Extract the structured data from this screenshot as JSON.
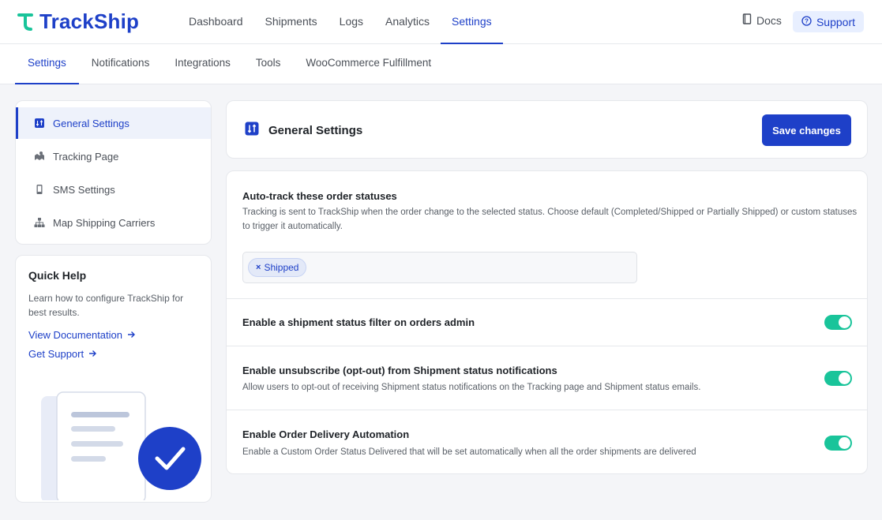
{
  "app": {
    "logo_text": "TrackShip",
    "brand_color": "#1e40c8",
    "accent_color": "#19c49a"
  },
  "topnav": {
    "items": [
      {
        "label": "Dashboard",
        "active": false
      },
      {
        "label": "Shipments",
        "active": false
      },
      {
        "label": "Logs",
        "active": false
      },
      {
        "label": "Analytics",
        "active": false
      },
      {
        "label": "Settings",
        "active": true
      }
    ],
    "docs_label": "Docs",
    "docs_icon": "book-icon",
    "support_label": "Support",
    "support_icon": "help-circle-icon"
  },
  "subnav": {
    "items": [
      {
        "label": "Settings",
        "active": true
      },
      {
        "label": "Notifications",
        "active": false
      },
      {
        "label": "Integrations",
        "active": false
      },
      {
        "label": "Tools",
        "active": false
      },
      {
        "label": "WooCommerce Fulfillment",
        "active": false
      }
    ]
  },
  "sidebar": {
    "items": [
      {
        "label": "General Settings",
        "icon": "sliders-icon",
        "active": true
      },
      {
        "label": "Tracking Page",
        "icon": "map-icon",
        "active": false
      },
      {
        "label": "SMS Settings",
        "icon": "phone-icon",
        "active": false
      },
      {
        "label": "Map Shipping Carriers",
        "icon": "sitemap-icon",
        "active": false
      }
    ]
  },
  "quick_help": {
    "title": "Quick Help",
    "text": "Learn how to configure TrackShip for best results.",
    "doc_link": "View Documentation",
    "support_link": "Get Support"
  },
  "main": {
    "title": "General Settings",
    "title_icon": "sliders-icon",
    "save_label": "Save changes",
    "settings": [
      {
        "title": "Auto-track these order statuses",
        "description": "Tracking is sent to TrackShip when the order change to the selected status. Choose default (Completed/Shipped or Partially Shipped) or custom statuses to trigger it automatically.",
        "selected_chip": "Shipped",
        "chip_remove": "×"
      },
      {
        "title": "Enable a shipment status filter on orders admin",
        "enabled": true
      },
      {
        "title": "Enable unsubscribe (opt-out) from Shipment status notifications",
        "description": "Allow users to opt-out of receiving Shipment status notifications on the Tracking page and Shipment status emails.",
        "enabled": true
      },
      {
        "title": "Enable Order Delivery Automation",
        "description": "Enable a Custom Order Status Delivered that will be set automatically when all the order shipments are delivered",
        "enabled": true
      }
    ]
  }
}
